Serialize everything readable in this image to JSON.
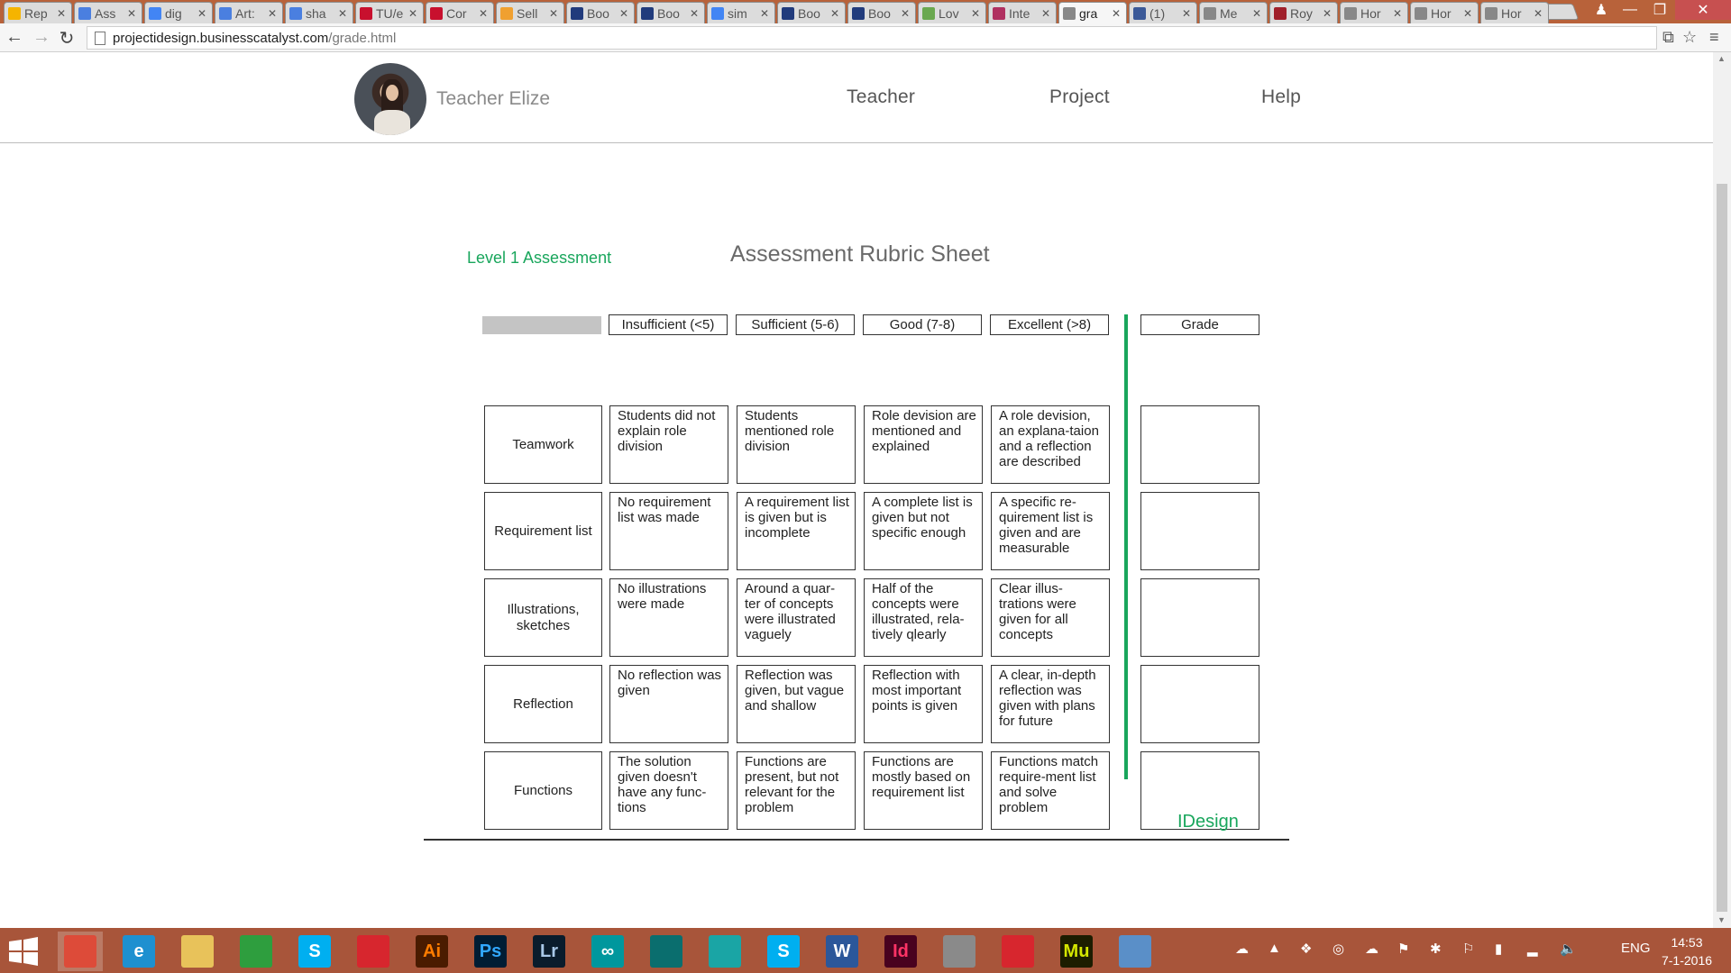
{
  "browser": {
    "tabs": [
      {
        "label": "Rep",
        "icon": "drive-icon",
        "color": "#f5b400"
      },
      {
        "label": "Ass",
        "icon": "docs-icon",
        "color": "#4a7fe0"
      },
      {
        "label": "dig",
        "icon": "google-icon",
        "color": "#4285f4"
      },
      {
        "label": "Art:",
        "icon": "docs-icon",
        "color": "#4a7fe0"
      },
      {
        "label": "sha",
        "icon": "docs-icon",
        "color": "#4a7fe0"
      },
      {
        "label": "TU/e",
        "icon": "tue-icon",
        "color": "#c8102e"
      },
      {
        "label": "Cor",
        "icon": "tue-icon",
        "color": "#c8102e"
      },
      {
        "label": "Sell",
        "icon": "shop-icon",
        "color": "#f0a030"
      },
      {
        "label": "Boo",
        "icon": "booking-icon",
        "color": "#213b7c"
      },
      {
        "label": "Boo",
        "icon": "booking-icon",
        "color": "#213b7c"
      },
      {
        "label": "sim",
        "icon": "google-icon",
        "color": "#4285f4"
      },
      {
        "label": "Boo",
        "icon": "booking-icon",
        "color": "#213b7c"
      },
      {
        "label": "Boo",
        "icon": "booking-icon",
        "color": "#213b7c"
      },
      {
        "label": "Lov",
        "icon": "fi-icon",
        "color": "#6aa84f"
      },
      {
        "label": "Inte",
        "icon": "interior-icon",
        "color": "#b03060"
      },
      {
        "label": "gra",
        "icon": "page-icon",
        "color": "#888888",
        "active": true
      },
      {
        "label": "(1)",
        "icon": "facebook-icon",
        "color": "#3b5998"
      },
      {
        "label": "Me",
        "icon": "page-icon",
        "color": "#888888"
      },
      {
        "label": "Roy",
        "icon": "royal-icon",
        "color": "#a0202a"
      },
      {
        "label": "Hor",
        "icon": "page-icon",
        "color": "#888888"
      },
      {
        "label": "Hor",
        "icon": "page-icon",
        "color": "#888888"
      },
      {
        "label": "Hor",
        "icon": "page-icon",
        "color": "#888888"
      }
    ],
    "url_host": "projectidesign.businesscatalyst.com",
    "url_path": "/grade.html"
  },
  "site": {
    "teacher_name": "Teacher Elize",
    "nav": [
      "Teacher",
      "Project",
      "Help"
    ]
  },
  "rubric": {
    "subtitle": "Level 1 Assessment",
    "title": "Assessment Rubric Sheet",
    "levels": [
      "Insufficient (<5)",
      "Sufficient (5-6)",
      "Good (7-8)",
      "Excellent (>8)"
    ],
    "grade_header": "Grade",
    "rows": [
      {
        "label": "Teamwork",
        "cells": [
          "Students did not explain role division",
          "Students mentioned role division",
          "Role devision are mentioned and explained",
          "A role devision, an explana-taion and a reflection are described"
        ]
      },
      {
        "label": "Requirement list",
        "cells": [
          "No requirement list was made",
          "A requirement list is given but is incomplete",
          "A complete list is given but not specific enough",
          "A specific re-quirement list is given and are measurable"
        ]
      },
      {
        "label": "Illustrations, sketches",
        "cells": [
          "No illustrations were made",
          "Around a quar-ter of concepts were illustrated vaguely",
          "Half of the concepts were illustrated, rela-tively qlearly",
          "Clear illus-trations were given for all concepts"
        ]
      },
      {
        "label": "Reflection",
        "cells": [
          "No reflection was given",
          "Reflection was given, but vague and shallow",
          "Reflection with most important points is given",
          "A clear, in-depth reflection was given with plans for future"
        ]
      },
      {
        "label": "Functions",
        "cells": [
          "The solution given doesn't have any func-tions",
          "Functions are present, but not relevant for the problem",
          "Functions are mostly based on requirement list",
          "Functions match require-ment list and solve problem"
        ]
      }
    ],
    "footer_brand": "IDesign",
    "accent_color": "#19a65c"
  },
  "taskbar": {
    "apps": [
      {
        "name": "chrome-icon",
        "label": "",
        "bg": "#dd4b39",
        "active": true
      },
      {
        "name": "internet-explorer-icon",
        "label": "e",
        "bg": "#1e90d0"
      },
      {
        "name": "file-explorer-icon",
        "label": "",
        "bg": "#e8c25a"
      },
      {
        "name": "store-icon",
        "label": "",
        "bg": "#2e9e3e"
      },
      {
        "name": "skype-icon",
        "label": "S",
        "bg": "#00aff0"
      },
      {
        "name": "creative-cloud-icon",
        "label": "",
        "bg": "#d7262e"
      },
      {
        "name": "illustrator-icon",
        "label": "Ai",
        "bg": "#4a1b00",
        "fg": "#ff7c00"
      },
      {
        "name": "photoshop-icon",
        "label": "Ps",
        "bg": "#001d34",
        "fg": "#31a8ff"
      },
      {
        "name": "lightroom-icon",
        "label": "Lr",
        "bg": "#0a1c2c",
        "fg": "#a8c8e8"
      },
      {
        "name": "arduino-icon",
        "label": "∞",
        "bg": "#00979d"
      },
      {
        "name": "3dsmax-icon",
        "label": "",
        "bg": "#0a6e6e"
      },
      {
        "name": "maya-icon",
        "label": "",
        "bg": "#1aa5a5"
      },
      {
        "name": "skype-icon-2",
        "label": "S",
        "bg": "#00aff0"
      },
      {
        "name": "word-icon",
        "label": "W",
        "bg": "#2b579a"
      },
      {
        "name": "indesign-icon",
        "label": "Id",
        "bg": "#49021f",
        "fg": "#ff3366"
      },
      {
        "name": "calculator-icon",
        "label": "",
        "bg": "#8a8a8a"
      },
      {
        "name": "creative-cloud-icon-2",
        "label": "",
        "bg": "#d7262e"
      },
      {
        "name": "muse-icon",
        "label": "Mu",
        "bg": "#1d1d00",
        "fg": "#d4e600"
      },
      {
        "name": "photos-icon",
        "label": "",
        "bg": "#5a8fc8"
      }
    ],
    "language": "ENG",
    "time": "14:53",
    "date": "7-1-2016"
  }
}
